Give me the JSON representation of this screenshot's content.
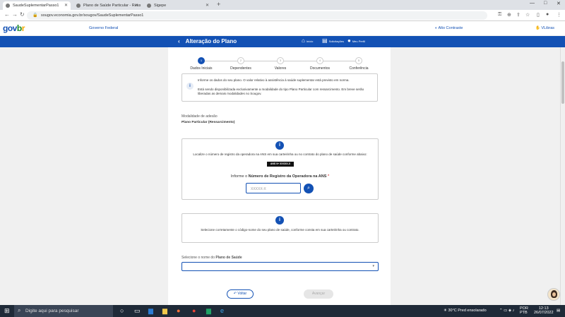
{
  "browser": {
    "tabs": [
      {
        "label": "SaudeSuplementarPasso1"
      },
      {
        "label": "Plano de Saúde Particular - Ress"
      },
      {
        "label": "Sigepe"
      }
    ],
    "url": "sougov.economia.gov.br/sougov/SaudeSuplementarPasso1"
  },
  "gov_header": {
    "logo": [
      "gov",
      "b",
      "r"
    ],
    "label": "Governo Federal",
    "contrast": "Alto Contraste",
    "videos": "VLibras"
  },
  "page": {
    "title": "Alteração do Plano",
    "nav": [
      {
        "icon": "home-icon",
        "label": "Início"
      },
      {
        "icon": "requests-icon",
        "label": "Solicitações"
      },
      {
        "icon": "user-icon",
        "label": "Meu Perfil"
      }
    ]
  },
  "stepper": {
    "steps": [
      {
        "num": "1",
        "label": "Dados Iniciais",
        "active": true
      },
      {
        "num": "2",
        "label": "Dependentes",
        "active": false
      },
      {
        "num": "3",
        "label": "Valores",
        "active": false
      },
      {
        "num": "4",
        "label": "Documentos",
        "active": false
      },
      {
        "num": "5",
        "label": "Conferência",
        "active": false
      }
    ]
  },
  "info": {
    "line1": "Informe os dados do seu plano. O valor relativo à assistência à saúde suplementar está previsto em norma.",
    "line2": "Está sendo disponibilizada exclusivamente a modalidade do tipo Plano Particular com ressarcimento. Em breve serão liberadas as demais modalidades no Sougov."
  },
  "modalidade": {
    "label": "Modalidade de adesão",
    "value": "Plano Particular (Ressarcimento)"
  },
  "ans_panel": {
    "instruction": "Localize o número de registro da operadora na ANS em sua carteirinha ou no contrato do plano de saúde conforme abaixo:",
    "badge": "ANS Nº XXXXX-X",
    "prompt_prefix": "Informe o ",
    "prompt_bold": "Número de Registro da Operadora na ANS",
    "prompt_required": " *",
    "input_placeholder": "XXXXX-X"
  },
  "plano_panel": {
    "instruction": "Selecione corretamente o código-nome do seu plano de saúde, conforme consta em sua carteirinha ou contrato."
  },
  "select_plano": {
    "label_prefix": "Selecione o nome do ",
    "label_bold": "Plano de Saúde",
    "value": ""
  },
  "actions": {
    "back": "Voltar",
    "next": "Avançar"
  },
  "taskbar": {
    "search_placeholder": "Digite aqui para pesquisar",
    "weather": "30°C  Pred ensolarado",
    "lang": "POR",
    "lang2": "PTB",
    "time": "12:13",
    "date": "26/07/2022"
  }
}
